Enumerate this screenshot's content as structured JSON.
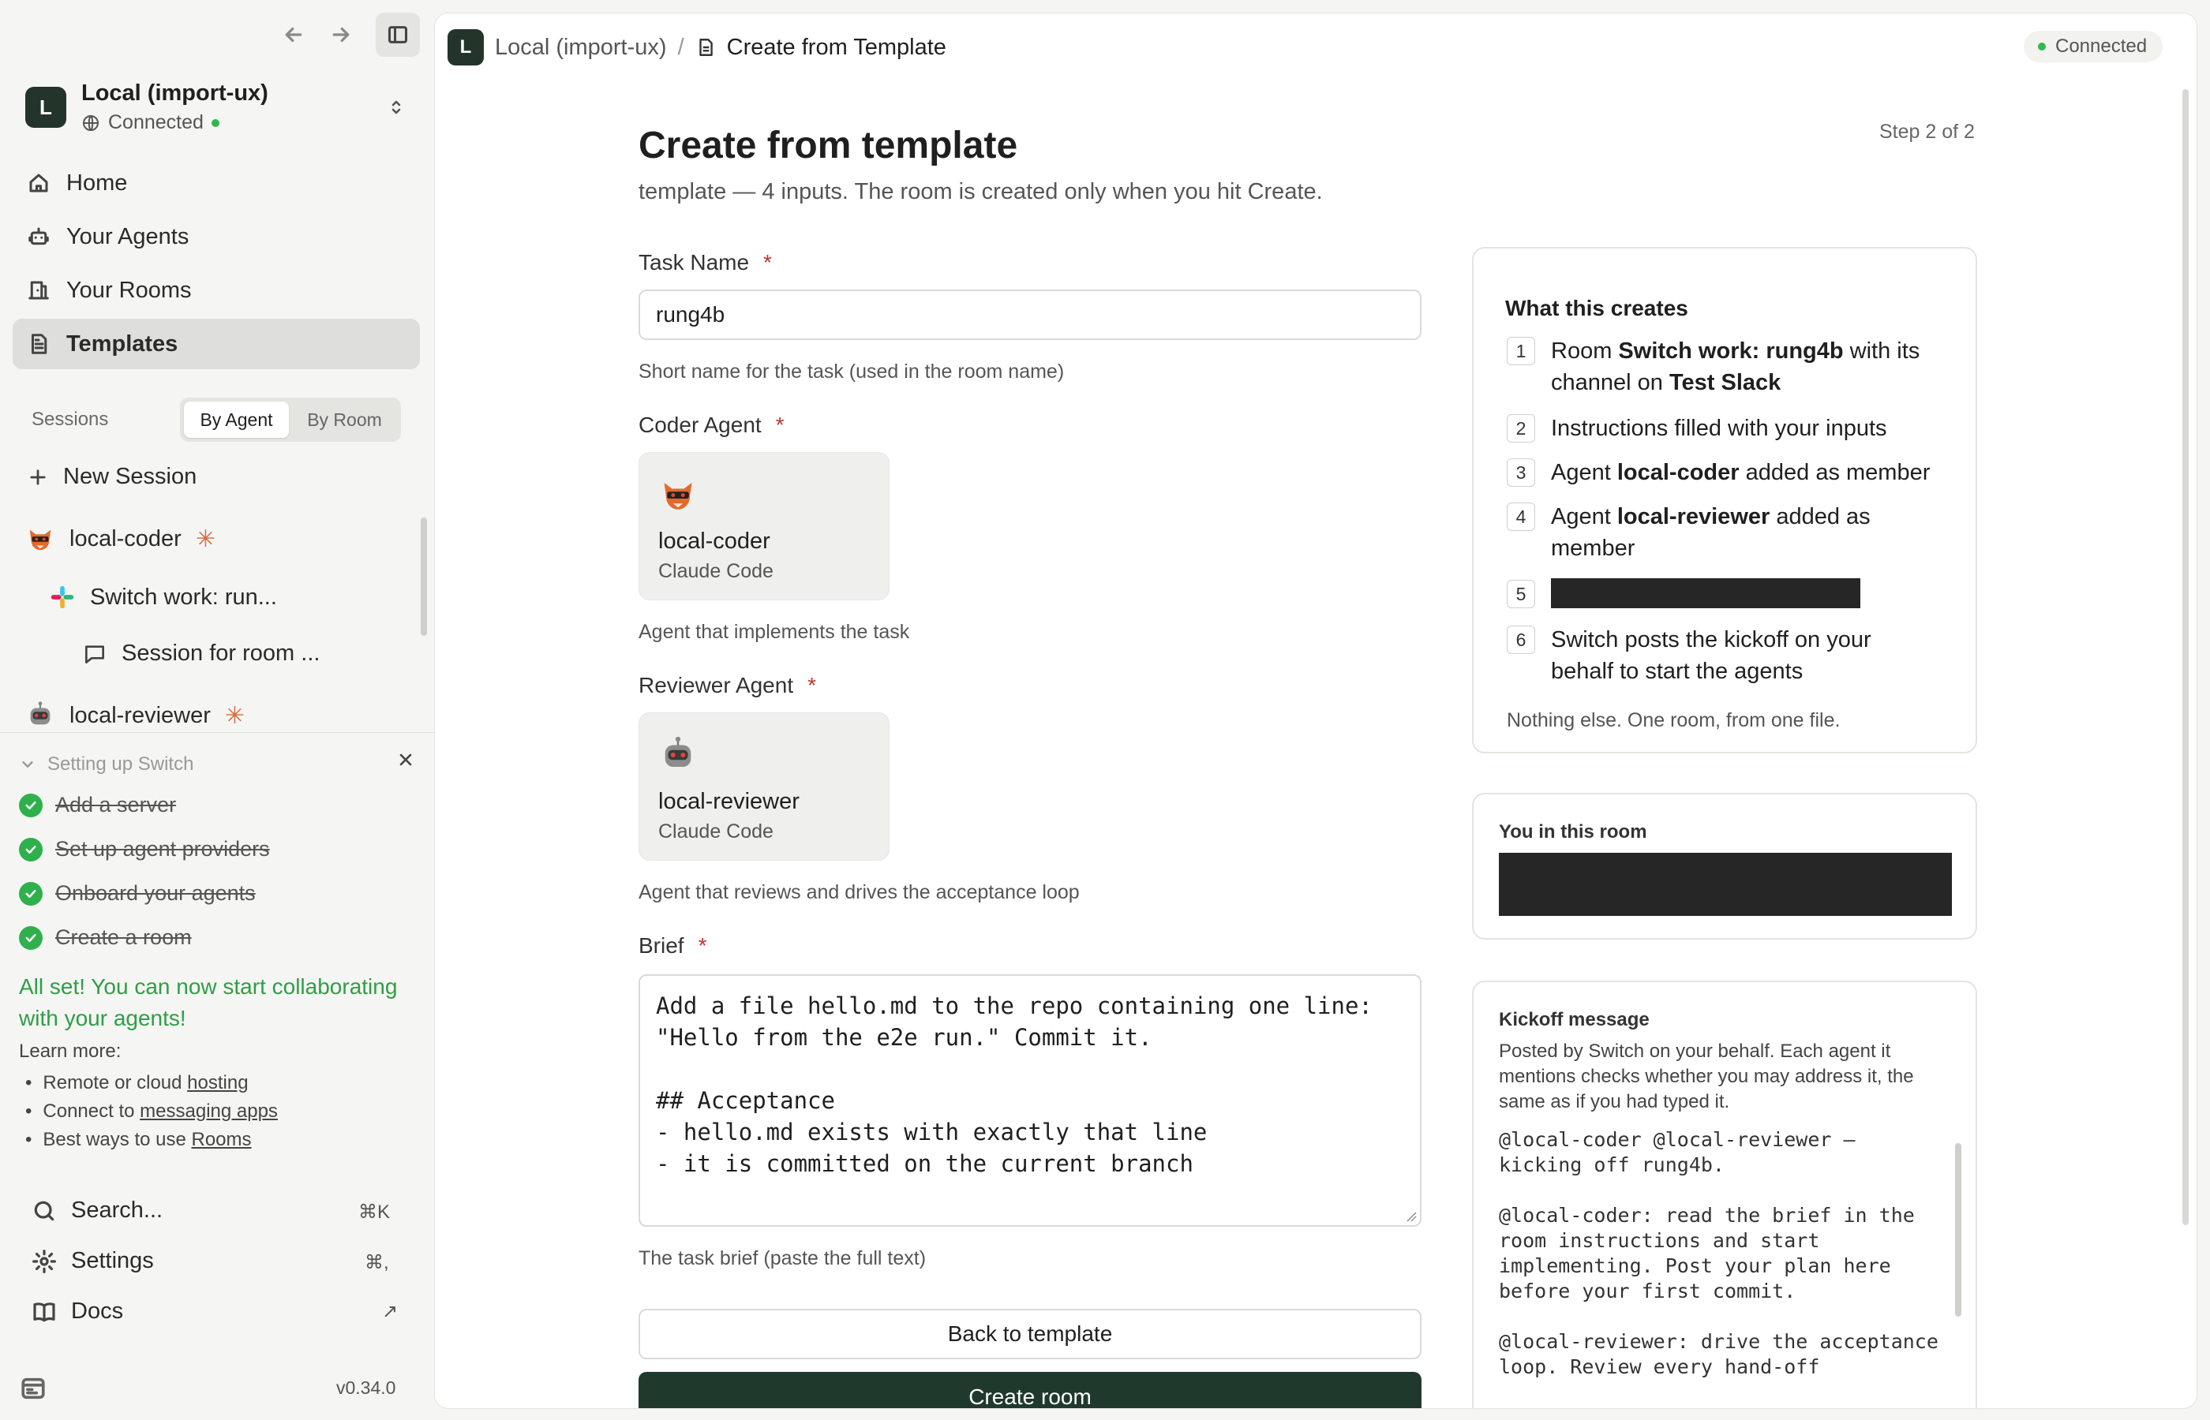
{
  "workspace": {
    "avatar_letter": "L",
    "name": "Local (import-ux)",
    "status": "Connected"
  },
  "nav": {
    "items": [
      {
        "label": "Home",
        "icon": "home-icon"
      },
      {
        "label": "Your Agents",
        "icon": "robot-icon"
      },
      {
        "label": "Your Rooms",
        "icon": "rooms-icon"
      },
      {
        "label": "Templates",
        "icon": "document-icon",
        "active": true
      }
    ]
  },
  "sessions": {
    "label": "Sessions",
    "toggle": [
      "By Agent",
      "By Room"
    ],
    "selected_toggle": "By Agent",
    "new_session": "New Session",
    "tree": {
      "agent1": "local-coder",
      "room1": "Switch work: run...",
      "session1": "Session for room ...",
      "agent2": "local-reviewer"
    }
  },
  "setup": {
    "title": "Setting up Switch",
    "steps": [
      "Add a server",
      "Set up agent providers",
      "Onboard your agents",
      "Create a room"
    ],
    "done_message": "All set! You can now start collaborating with your agents!",
    "learn_more": "Learn more:",
    "links": [
      {
        "prefix": "Remote or cloud",
        "link": "hosting"
      },
      {
        "prefix": "Connect to",
        "link": "messaging apps"
      },
      {
        "prefix": "Best ways to use",
        "link": "Rooms"
      }
    ]
  },
  "bottom": {
    "search": "Search...",
    "search_shortcut": "⌘K",
    "settings": "Settings",
    "settings_shortcut": "⌘,",
    "docs": "Docs",
    "docs_arrow": "↗",
    "version": "v0.34.0"
  },
  "header": {
    "avatar_letter": "L",
    "workspace": "Local (import-ux)",
    "separator": "/",
    "page": "Create from Template",
    "status": "Connected"
  },
  "form": {
    "title": "Create from template",
    "subtitle": "template — 4 inputs. The room is created only when you hit Create.",
    "step": "Step 2 of 2",
    "required_mark": "*",
    "task_name_label": "Task Name",
    "task_name_value": "rung4b",
    "task_name_hint": "Short name for the task (used in the room name)",
    "coder_label": "Coder Agent",
    "coder_name": "local-coder",
    "coder_runtime": "Claude Code",
    "coder_hint": "Agent that implements the task",
    "reviewer_label": "Reviewer Agent",
    "reviewer_name": "local-reviewer",
    "reviewer_runtime": "Claude Code",
    "reviewer_hint": "Agent that reviews and drives the acceptance loop",
    "brief_label": "Brief",
    "brief_lines": [
      "Add a file hello.md to the repo containing one line:",
      "\"Hello from the e2e run.\" Commit it.",
      "",
      "## Acceptance",
      "- hello.md exists with exactly that line",
      "- it is committed on the current branch"
    ],
    "brief_hint": "The task brief (paste the full text)",
    "back_button": "Back to template",
    "create_button": "Create room"
  },
  "creates_panel": {
    "title": "What this creates",
    "items": [
      {
        "n": "1",
        "a": "Room ",
        "b": "Switch work: rung4b",
        "c": " with its channel on ",
        "d": "Test Slack"
      },
      {
        "n": "2",
        "a": "Instructions filled with your inputs"
      },
      {
        "n": "3",
        "a": "Agent ",
        "b": "local-coder",
        "c": " added as member"
      },
      {
        "n": "4",
        "a": "Agent ",
        "b": "local-reviewer",
        "c": " added as member"
      },
      {
        "n": "5"
      },
      {
        "n": "6",
        "a": "Switch posts the kickoff on your behalf to start the agents"
      }
    ],
    "footer": "Nothing else. One room, from one file."
  },
  "you_panel": {
    "title": "You in this room"
  },
  "kickoff_panel": {
    "title": "Kickoff message",
    "description": "Posted by Switch on your behalf. Each agent it mentions checks whether you may address it, the same as if you had typed it.",
    "message": "@local-coder @local-reviewer — kicking off rung4b.\n\n@local-coder: read the brief in the room instructions and start implementing. Post your plan here before your first commit.\n\n@local-reviewer: drive the acceptance loop. Review every hand-off"
  },
  "colors": {
    "accent_dark": "#1f3a2c",
    "connected": "#2fb84d",
    "success": "#2e9e47",
    "required": "#c4332e",
    "spark": "#d9683a"
  }
}
